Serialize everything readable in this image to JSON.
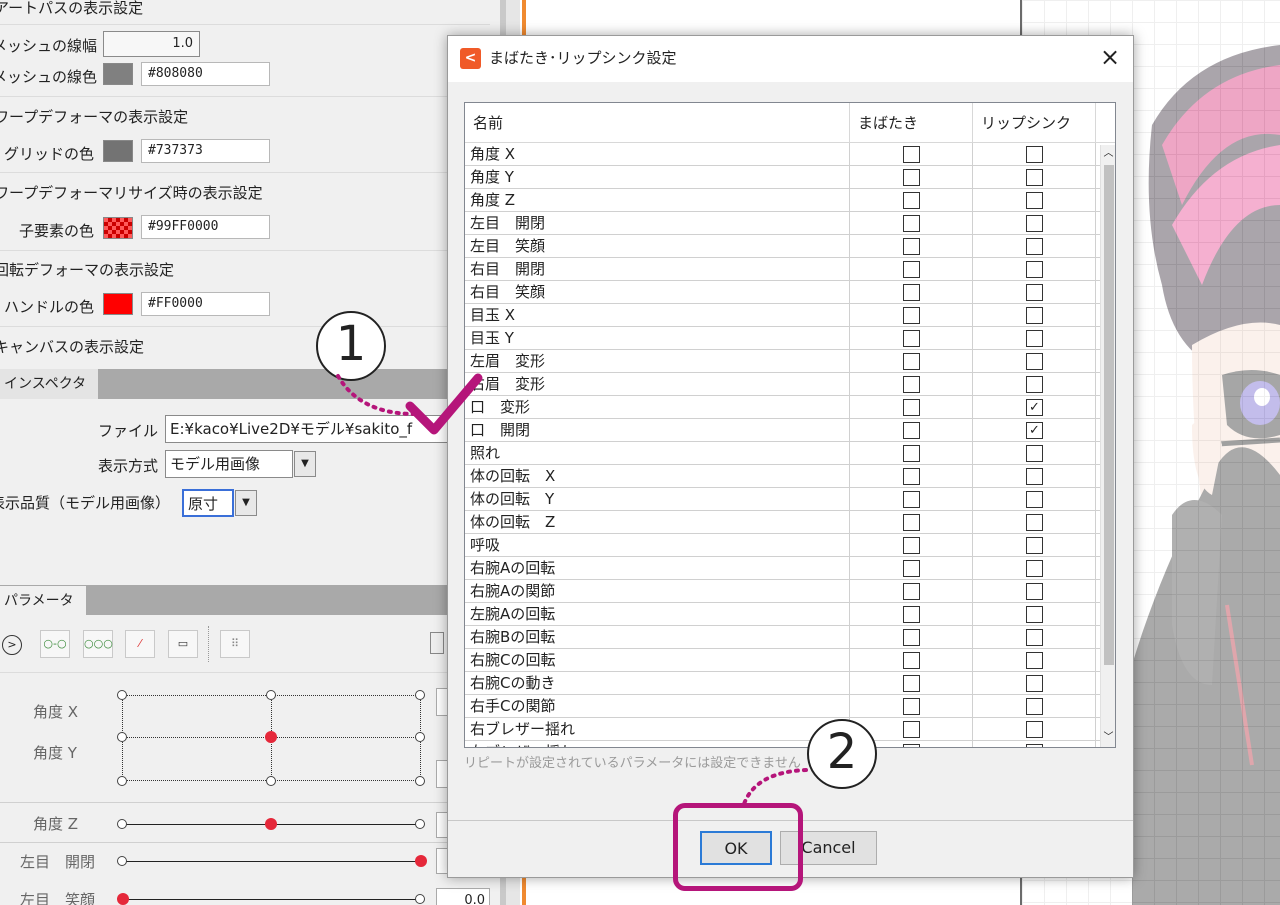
{
  "left_panel": {
    "section_partial": "アートパスの表示設定",
    "mesh_width_label": "メッシュの線幅",
    "mesh_width_value": "1.0",
    "mesh_color_label": "メッシュの線色",
    "mesh_color_hex": "#808080",
    "warp_section": "ワープデフォーマの表示設定",
    "grid_color_label": "グリッドの色",
    "grid_color_hex": "#737373",
    "warp_resize_section": "ワープデフォーマリサイズ時の表示設定",
    "child_color_label": "子要素の色",
    "child_color_hex": "#99FF0000",
    "rot_section": "回転デフォーマの表示設定",
    "handle_color_label": "ハンドルの色",
    "handle_color_hex": "#FF0000",
    "canvas_section": "キャンバスの表示設定",
    "inspector_tab": "インスペクタ",
    "file_label": "ファイル",
    "file_value": "E:¥kaco¥Live2D¥モデル¥sakito_f",
    "display_mode_label": "表示方式",
    "display_mode_value": "モデル用画像",
    "quality_label": "表示品質（モデル用画像）",
    "quality_value": "原寸",
    "param_tab": "パラメータ",
    "params": [
      "角度 X",
      "角度 Y",
      "角度 Z",
      "左目　開閉",
      "左目　笑顔"
    ],
    "last_value": "0.0"
  },
  "dialog": {
    "title": "まばたき･リップシンク設定",
    "close_glyph": "×",
    "columns": [
      "名前",
      "まばたき",
      "リップシンク"
    ],
    "rows": [
      {
        "name": "角度 X",
        "blink": false,
        "lip": false
      },
      {
        "name": "角度 Y",
        "blink": false,
        "lip": false
      },
      {
        "name": "角度 Z",
        "blink": false,
        "lip": false
      },
      {
        "name": "左目　開閉",
        "blink": false,
        "lip": false
      },
      {
        "name": "左目　笑顔",
        "blink": false,
        "lip": false
      },
      {
        "name": "右目　開閉",
        "blink": false,
        "lip": false
      },
      {
        "name": "右目　笑顔",
        "blink": false,
        "lip": false
      },
      {
        "name": "目玉 X",
        "blink": false,
        "lip": false
      },
      {
        "name": "目玉 Y",
        "blink": false,
        "lip": false
      },
      {
        "name": "左眉　変形",
        "blink": false,
        "lip": false
      },
      {
        "name": "右眉　変形",
        "blink": false,
        "lip": false
      },
      {
        "name": "口　変形",
        "blink": false,
        "lip": true
      },
      {
        "name": "口　開閉",
        "blink": false,
        "lip": true
      },
      {
        "name": "照れ",
        "blink": false,
        "lip": false
      },
      {
        "name": "体の回転　X",
        "blink": false,
        "lip": false
      },
      {
        "name": "体の回転　Y",
        "blink": false,
        "lip": false
      },
      {
        "name": "体の回転　Z",
        "blink": false,
        "lip": false
      },
      {
        "name": "呼吸",
        "blink": false,
        "lip": false
      },
      {
        "name": "右腕Aの回転",
        "blink": false,
        "lip": false
      },
      {
        "name": "右腕Aの関節",
        "blink": false,
        "lip": false
      },
      {
        "name": "左腕Aの回転",
        "blink": false,
        "lip": false
      },
      {
        "name": "右腕Bの回転",
        "blink": false,
        "lip": false
      },
      {
        "name": "右腕Cの回転",
        "blink": false,
        "lip": false
      },
      {
        "name": "右腕Cの動き",
        "blink": false,
        "lip": false
      },
      {
        "name": "右手Cの関節",
        "blink": false,
        "lip": false
      },
      {
        "name": "右ブレザー揺れ",
        "blink": false,
        "lip": false
      },
      {
        "name": "左ブレザー揺れ",
        "blink": false,
        "lip": false
      }
    ],
    "note": "リピートが設定されているパラメータには設定できません",
    "ok_label": "OK",
    "cancel_label": "Cancel"
  },
  "annotations": {
    "step1": "1",
    "step2": "2"
  },
  "colors": {
    "accent": "#b5157a",
    "swatch_mesh": "#808080",
    "swatch_grid": "#737373",
    "swatch_handle": "#FF0000"
  }
}
